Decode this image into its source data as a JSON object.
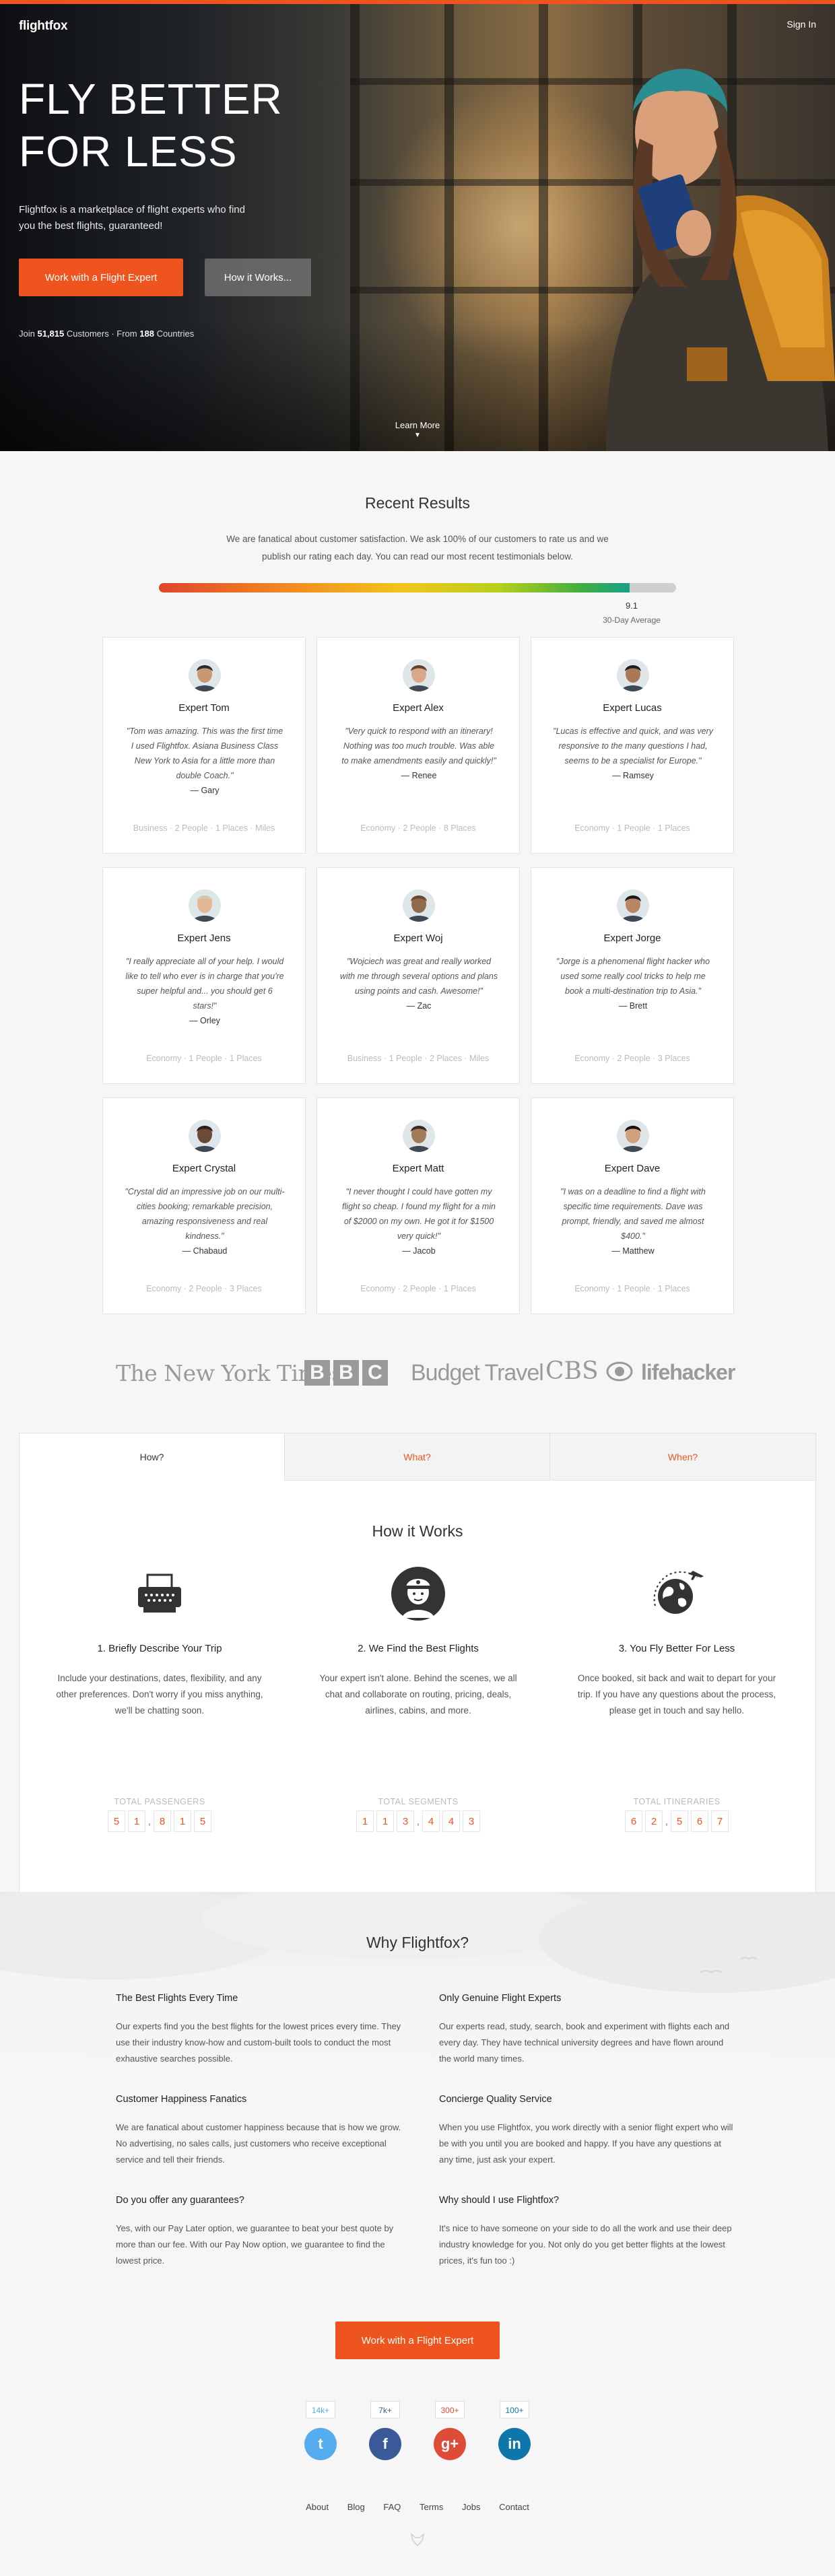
{
  "brand": {
    "accent": "#f0541e",
    "logo": "flightfox"
  },
  "header": {
    "sign_in": "Sign In"
  },
  "hero": {
    "title": "FLY BETTER FOR LESS",
    "subtitle": "Flightfox is a marketplace of flight experts who find you the best flights, guaranteed!",
    "primary_button": "Work with a Flight Expert",
    "secondary_button": "How it Works...",
    "stats_prefix": "Join",
    "customers": "51,815",
    "stats_mid": "Customers · From",
    "countries": "188",
    "stats_suffix": "Countries",
    "learn_more": "Learn More"
  },
  "recent": {
    "title": "Recent Results",
    "description": "We are fanatical about customer satisfaction. We ask 100% of our customers to rate us and we publish our rating each day. You can read our most recent testimonials below.",
    "rating_value": "9.1",
    "rating_fraction": 0.91,
    "rating_label": "30-Day Average",
    "cards": [
      {
        "expert": "Expert Tom",
        "quote": "\"Tom was amazing. This was the first time I used Flightfox. Asiana Business Class New York to Asia for a little more than double Coach.\"",
        "author": "— Gary",
        "meta": "Business · 2 People · 1 Places · Miles"
      },
      {
        "expert": "Expert Alex",
        "quote": "\"Very quick to respond with an itinerary! Nothing was too much trouble. Was able to make amendments easily and quickly!\"",
        "author": "— Renee",
        "meta": "Economy · 2 People · 8 Places"
      },
      {
        "expert": "Expert Lucas",
        "quote": "\"Lucas is effective and quick, and was very responsive to the many questions I had, seems to be a specialist for Europe.\"",
        "author": "— Ramsey",
        "meta": "Economy · 1 People · 1 Places"
      },
      {
        "expert": "Expert Jens",
        "quote": "\"I really appreciate all of your help. I would like to tell who ever is in charge that you're super helpful and... you should get 6 stars!\"",
        "author": "— Orley",
        "meta": "Economy · 1 People · 1 Places"
      },
      {
        "expert": "Expert Woj",
        "quote": "\"Wojciech was great and really worked with me through several options and plans using points and cash. Awesome!\"",
        "author": "— Zac",
        "meta": "Business · 1 People · 2 Places · Miles"
      },
      {
        "expert": "Expert Jorge",
        "quote": "\"Jorge is a phenomenal flight hacker who used some really cool tricks to help me book a multi-destination trip to Asia.\"",
        "author": "— Brett",
        "meta": "Economy · 2 People · 3 Places"
      },
      {
        "expert": "Expert Crystal",
        "quote": "\"Crystal did an impressive job on our multi-cities booking; remarkable precision, amazing responsiveness and real kindness.\"",
        "author": "— Chabaud",
        "meta": "Economy · 2 People · 3 Places"
      },
      {
        "expert": "Expert Matt",
        "quote": "\"I never thought I could have gotten my flight so cheap. I found my flight for a min of $2000 on my own. He got it for $1500 very quick!\"",
        "author": "— Jacob",
        "meta": "Economy · 2 People · 1 Places"
      },
      {
        "expert": "Expert Dave",
        "quote": "\"I was on a deadline to find a flight with specific time requirements. Dave was prompt, friendly, and saved me almost $400.\"",
        "author": "— Matthew",
        "meta": "Economy · 1 People · 1 Places"
      }
    ]
  },
  "press": {
    "nyt": "The New York Times",
    "bbc": [
      "B",
      "B",
      "C"
    ],
    "bt": "Budget Travel",
    "cbs": "CBS",
    "lh": "lifehacker"
  },
  "how": {
    "tabs": [
      "How?",
      "What?",
      "When?"
    ],
    "title": "How it Works",
    "steps": [
      {
        "title": "1. Briefly Describe Your Trip",
        "text": "Include your destinations, dates, flexibility, and any other preferences. Don't worry if you miss anything, we'll be chatting soon."
      },
      {
        "title": "2. We Find the Best Flights",
        "text": "Your expert isn't alone. Behind the scenes, we all chat and collaborate on routing, pricing, deals, airlines, cabins, and more."
      },
      {
        "title": "3. You Fly Better For Less",
        "text": "Once booked, sit back and wait to depart for your trip. If you have any questions about the process, please get in touch and say hello."
      }
    ],
    "counters": [
      {
        "label": "TOTAL PASSENGERS",
        "digits": [
          "5",
          "1",
          ",",
          "8",
          "1",
          "5"
        ]
      },
      {
        "label": "TOTAL SEGMENTS",
        "digits": [
          "1",
          "1",
          "3",
          ",",
          "4",
          "4",
          "3"
        ]
      },
      {
        "label": "TOTAL ITINERARIES",
        "digits": [
          "6",
          "2",
          ",",
          "5",
          "6",
          "7"
        ]
      }
    ]
  },
  "why": {
    "title": "Why Flightfox?",
    "items": [
      {
        "title": "The Best Flights Every Time",
        "text": "Our experts find you the best flights for the lowest prices every time. They use their industry know-how and custom-built tools to conduct the most exhaustive searches possible."
      },
      {
        "title": "Only Genuine Flight Experts",
        "text": "Our experts read, study, search, book and experiment with flights each and every day. They have technical university degrees and have flown around the world many times."
      },
      {
        "title": "Customer Happiness Fanatics",
        "text": "We are fanatical about customer happiness because that is how we grow. No advertising, no sales calls, just customers who receive exceptional service and tell their friends."
      },
      {
        "title": "Concierge Quality Service",
        "text": "When you use Flightfox, you work directly with a senior flight expert who will be with you until you are booked and happy. If you have any questions at any time, just ask your expert."
      },
      {
        "title": "Do you offer any guarantees?",
        "text": "Yes, with our Pay Later option, we guarantee to beat your best quote by more than our fee. With our Pay Now option, we guarantee to find the lowest price."
      },
      {
        "title": "Why should I use Flightfox?",
        "text": "It's nice to have someone on your side to do all the work and use their deep industry knowledge for you. Not only do you get better flights at the lowest prices, it's fun too :)"
      }
    ],
    "cta": "Work with a Flight Expert"
  },
  "social": [
    {
      "count": "14k+",
      "icon": "twitter-icon",
      "glyph": "t",
      "color": "#55acee",
      "text_color": "#55acee"
    },
    {
      "count": "7k+",
      "icon": "facebook-icon",
      "glyph": "f",
      "color": "#3b5998",
      "text_color": "#3b5998"
    },
    {
      "count": "300+",
      "icon": "google-plus-icon",
      "glyph": "g+",
      "color": "#dd4b39",
      "text_color": "#dd4b39"
    },
    {
      "count": "100+",
      "icon": "linkedin-icon",
      "glyph": "in",
      "color": "#0e76a8",
      "text_color": "#0e76a8"
    }
  ],
  "footer": {
    "links": [
      "About",
      "Blog",
      "FAQ",
      "Terms",
      "Jobs",
      "Contact"
    ]
  }
}
